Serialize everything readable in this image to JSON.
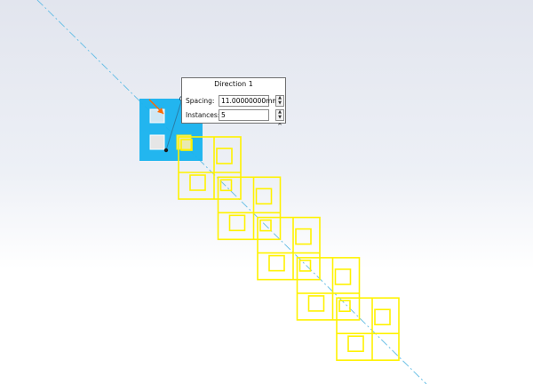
{
  "direction_panel": {
    "title": "Direction 1",
    "spacing_label": "Spacing:",
    "spacing_value": "11.00000000mm",
    "instances_label": "Instances:",
    "instances_value": "5"
  },
  "icons": {
    "spin_up": "spin-up-arrow-icon",
    "spin_down": "spin-down-arrow-icon",
    "collapse": "chevron-up-icon"
  },
  "colors": {
    "seed_feature": "#17b2ee",
    "preview": "#fff200",
    "axis": "#6cc0e6",
    "callout": "#2a7ea8"
  },
  "pattern": {
    "instances": 5
  }
}
